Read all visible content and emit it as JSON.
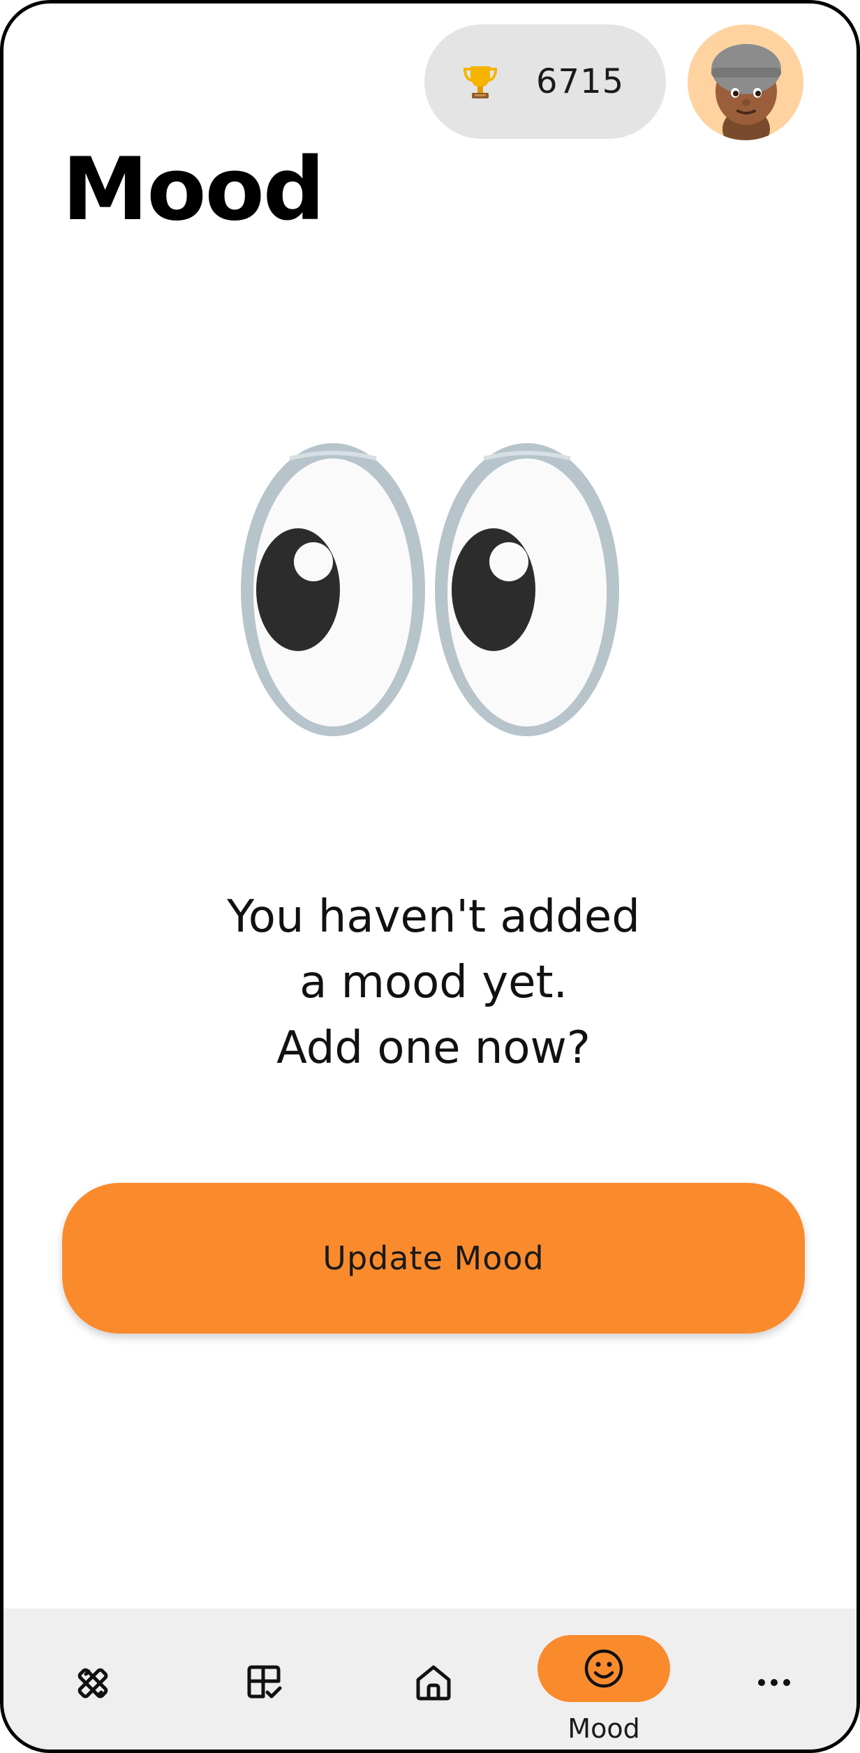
{
  "header": {
    "score": "6715",
    "score_icon": "trophy-icon",
    "avatar_icon": "memoji-avatar"
  },
  "page": {
    "title": "Mood"
  },
  "empty_state": {
    "illustration": "eyes-emoji",
    "lines": [
      "You haven't added",
      "a mood yet.",
      "Add one now?"
    ]
  },
  "actions": {
    "update_label": "Update Mood"
  },
  "nav": {
    "items": [
      {
        "icon": "tools-icon"
      },
      {
        "icon": "checklist-grid-icon"
      },
      {
        "icon": "home-icon"
      },
      {
        "icon": "smiley-icon",
        "label": "Mood",
        "active": true
      },
      {
        "icon": "more-icon"
      }
    ]
  },
  "colors": {
    "accent": "#fa8b2d",
    "pill_bg": "#e4e4e4",
    "nav_bg": "#efefef",
    "avatar_bg": "#ffd3a0"
  }
}
